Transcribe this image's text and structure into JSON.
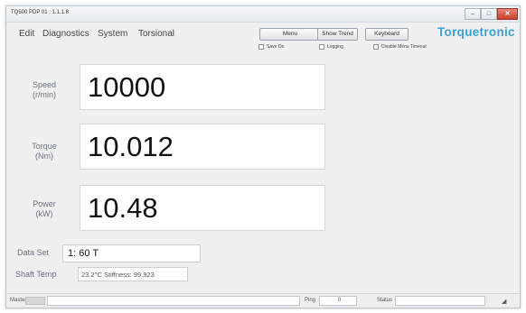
{
  "window": {
    "title": "TQ500 PDP 01 : 1.1.1.8"
  },
  "titlebar_controls": {
    "minimize": "‒",
    "maximize": "□",
    "close": "✕"
  },
  "menu": [
    "Edit",
    "Diagnostics",
    "System",
    "Torsional"
  ],
  "buttons": {
    "menu": "Menu",
    "show_trend": "Show Trend",
    "keyboard": "Keyboard"
  },
  "checkboxes": {
    "save_on": "Save On",
    "logging": "Logging",
    "disable_menu_timeout": "Disable Menu Timeout"
  },
  "logo": "Torquetronic",
  "readings": [
    {
      "label": "Speed",
      "unit": "(r/min)",
      "value": "10000"
    },
    {
      "label": "Torque",
      "unit": "(Nm)",
      "value": "10.012"
    },
    {
      "label": "Power",
      "unit": "(kW)",
      "value": "10.48"
    }
  ],
  "dataset": {
    "label": "Data Set",
    "value": "1: 60 T"
  },
  "shaft": {
    "label": "Shaft Temp",
    "value": "23.2°C  Stiffness: 99.923"
  },
  "statusbar": {
    "master_label": "Master",
    "ping_label": "Ping",
    "ping_value": "0",
    "status_label": "Status",
    "status_value": "",
    "corner_glyph": "◢"
  },
  "colors": {
    "logo": "#3aa0d8",
    "close_button": "#c8402e",
    "window_bg": "#f0f0f0"
  }
}
